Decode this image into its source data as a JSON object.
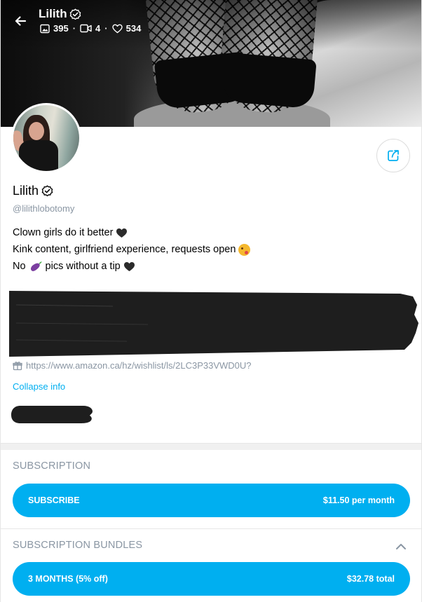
{
  "header": {
    "name": "Lilith",
    "stats": {
      "photos": "395",
      "videos": "4",
      "likes": "534"
    }
  },
  "profile": {
    "name": "Lilith",
    "handle": "@lilithlobotomy",
    "bio": {
      "line1": "Clown girls do it better",
      "line2": "Kink content, girlfriend experience, requests open",
      "line3_prefix": "No",
      "line3_suffix": "pics without a tip"
    },
    "link": "https://www.amazon.ca/hz/wishlist/ls/2LC3P33VWD0U?",
    "collapse_label": "Collapse info"
  },
  "subscription": {
    "title": "SUBSCRIPTION",
    "subscribe_label": "SUBSCRIBE",
    "price_label": "$11.50 per month"
  },
  "bundles": {
    "title": "SUBSCRIPTION BUNDLES",
    "items": [
      {
        "label": "3 MONTHS (5% off)",
        "total": "$32.78 total"
      }
    ]
  },
  "colors": {
    "accent": "#00aff0",
    "muted_text": "#8a96a3",
    "redaction": "#1e1e1e"
  },
  "icons": [
    "back-arrow-icon",
    "verified-icon",
    "image-icon",
    "video-icon",
    "heart-icon",
    "share-icon",
    "gift-icon",
    "chevron-up-icon",
    "eggplant-icon",
    "face-tongue-icon"
  ]
}
